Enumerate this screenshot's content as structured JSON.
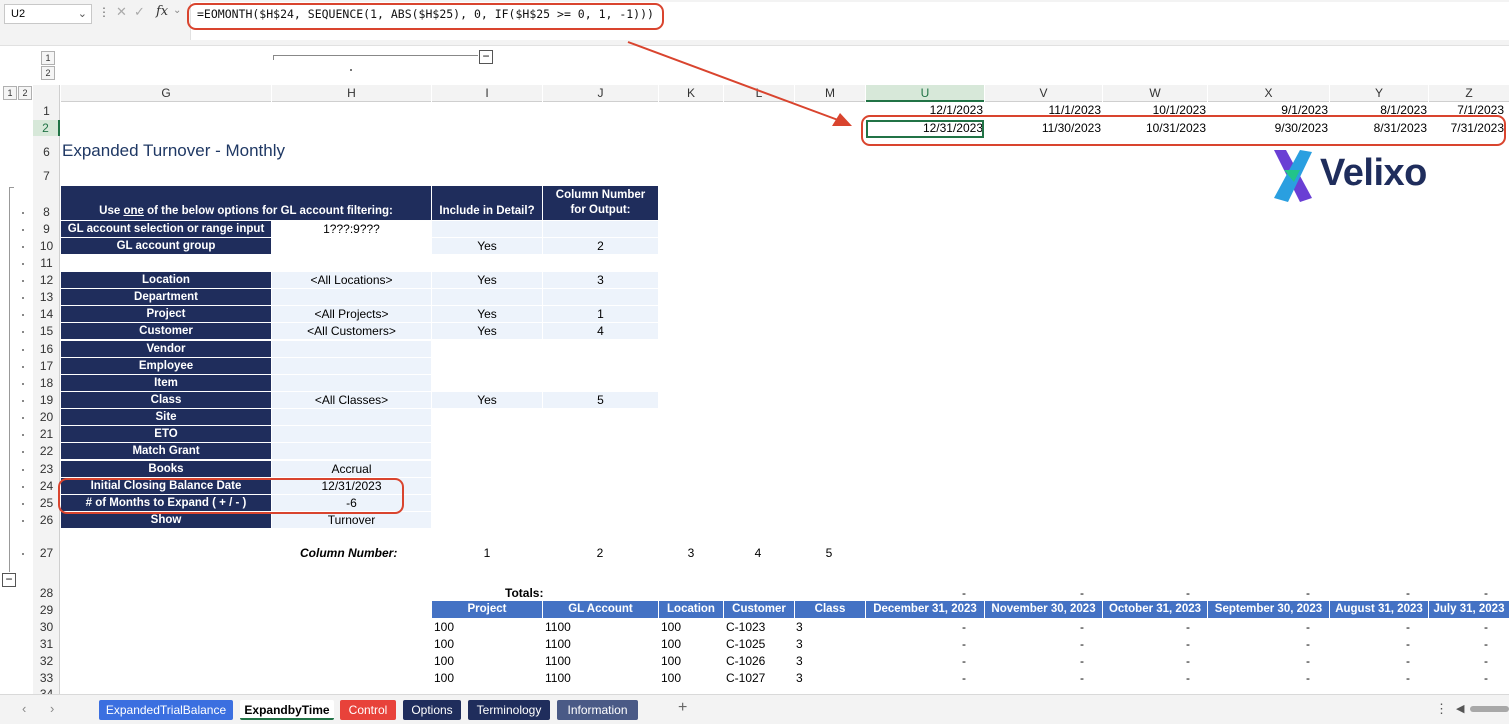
{
  "formula_bar": {
    "name_box": "U2",
    "formula": "=EOMONTH($H$24, SEQUENCE(1, ABS($H$25), 0, IF($H$25 >= 0, 1, -1)))",
    "fx": "fx"
  },
  "outline": {
    "levels_col": [
      "1",
      "2"
    ],
    "levels_row": [
      "1",
      "2"
    ]
  },
  "columns": [
    "G",
    "H",
    "I",
    "J",
    "K",
    "L",
    "M",
    "U",
    "V",
    "W",
    "X",
    "Y",
    "Z"
  ],
  "selected_column": "U",
  "rows": [
    "1",
    "2",
    "6",
    "7",
    "8",
    "9",
    "10",
    "11",
    "12",
    "13",
    "14",
    "15",
    "16",
    "17",
    "18",
    "19",
    "20",
    "21",
    "22",
    "23",
    "24",
    "25",
    "26",
    "27",
    "28",
    "29",
    "30",
    "31",
    "32",
    "33",
    "34"
  ],
  "selected_row": "2",
  "dates_row1": [
    "12/1/2023",
    "11/1/2023",
    "10/1/2023",
    "9/1/2023",
    "8/1/2023",
    "7/1/2023"
  ],
  "dates_row2": [
    "12/31/2023",
    "11/30/2023",
    "10/31/2023",
    "9/30/2023",
    "8/31/2023",
    "7/31/2023"
  ],
  "title": "Expanded Turnover - Monthly",
  "logo_text": "Velixo",
  "filter_table": {
    "header_left_pre": "Use ",
    "header_left_underlined": "one",
    "header_left_post": " of the below options for GL account filtering:",
    "header_include": "Include in Detail?",
    "header_colnum": "Column Number for Output:",
    "rows": [
      {
        "label": "GL account selection or range input",
        "value": "1???:9???",
        "include": "",
        "col": ""
      },
      {
        "label": "GL account group",
        "value": "",
        "include": "Yes",
        "col": "2"
      },
      {
        "label": "Location",
        "value": "<All Locations>",
        "include": "Yes",
        "col": "3"
      },
      {
        "label": "Department",
        "value": "",
        "include": "",
        "col": ""
      },
      {
        "label": "Project",
        "value": "<All Projects>",
        "include": "Yes",
        "col": "1"
      },
      {
        "label": "Customer",
        "value": "<All Customers>",
        "include": "Yes",
        "col": "4"
      },
      {
        "label": "Vendor",
        "value": "",
        "include": "",
        "col": ""
      },
      {
        "label": "Employee",
        "value": "",
        "include": "",
        "col": ""
      },
      {
        "label": "Item",
        "value": "",
        "include": "",
        "col": ""
      },
      {
        "label": "Class",
        "value": "<All Classes>",
        "include": "Yes",
        "col": "5"
      },
      {
        "label": "Site",
        "value": "",
        "include": "",
        "col": ""
      },
      {
        "label": "ETO",
        "value": "",
        "include": "",
        "col": ""
      },
      {
        "label": "Match Grant",
        "value": "",
        "include": "",
        "col": ""
      },
      {
        "label": "Books",
        "value": "Accrual",
        "include": "",
        "col": ""
      },
      {
        "label": "Initial Closing Balance Date",
        "value": "12/31/2023",
        "include": "",
        "col": ""
      },
      {
        "label": "# of Months to Expand ( + / - )",
        "value": "-6",
        "include": "",
        "col": ""
      },
      {
        "label": "Show",
        "value": "Turnover",
        "include": "",
        "col": ""
      }
    ]
  },
  "column_number": {
    "label": "Column Number:",
    "values": [
      "1",
      "2",
      "3",
      "4",
      "5"
    ]
  },
  "totals": {
    "label": "Totals:",
    "values": [
      "-",
      "-",
      "-",
      "-",
      "-",
      "-"
    ]
  },
  "detail_headers": [
    "Project",
    "GL Account",
    "Location",
    "Customer",
    "Class",
    "December 31, 2023",
    "November 30, 2023",
    "October 31, 2023",
    "September 30, 2023",
    "August 31, 2023",
    "July 31, 2023"
  ],
  "detail_rows": [
    [
      "100",
      "1100",
      "100",
      "C-1023",
      "3",
      "-",
      "-",
      "-",
      "-",
      "-",
      "-"
    ],
    [
      "100",
      "1100",
      "100",
      "C-1025",
      "3",
      "-",
      "-",
      "-",
      "-",
      "-",
      "-"
    ],
    [
      "100",
      "1100",
      "100",
      "C-1026",
      "3",
      "-",
      "-",
      "-",
      "-",
      "-",
      "-"
    ],
    [
      "100",
      "1100",
      "100",
      "C-1027",
      "3",
      "-",
      "-",
      "-",
      "-",
      "-",
      "-"
    ]
  ],
  "sheet_tabs": [
    {
      "label": "ExpandedTrialBalance",
      "color": "#3b6fe0"
    },
    {
      "label": "ExpandbyTime",
      "color": "#ffffff"
    },
    {
      "label": "Control",
      "color": "#e8423a"
    },
    {
      "label": "Options",
      "color": "#1f2d5c"
    },
    {
      "label": "Terminology",
      "color": "#1f2d5c"
    },
    {
      "label": "Information",
      "color": "#4a5a86"
    }
  ],
  "colors": {
    "navy": "#1f2d5c",
    "header_blue": "#4472c4",
    "highlight_red": "#d9442e",
    "excel_green": "#217346"
  }
}
